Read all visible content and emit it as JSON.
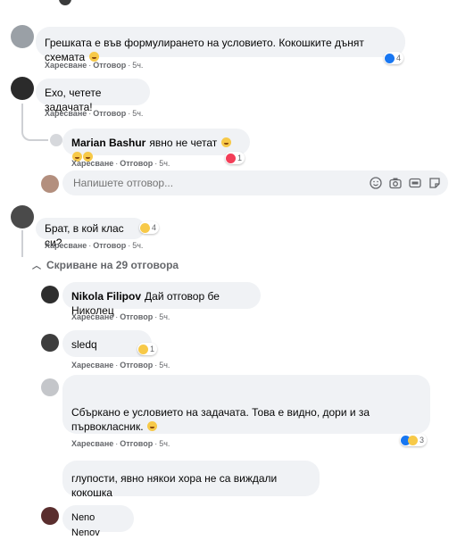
{
  "comments": [
    {
      "text": "Грешката е във формулирането на условието. Кокошките дънят схемата",
      "actions": {
        "like": "Харесване",
        "reply": "Отговор",
        "time": "5ч."
      },
      "reactions": {
        "count": "4"
      }
    },
    {
      "text": "Ехо, четете задачата!",
      "actions": {
        "like": "Харесване",
        "reply": "Отговор",
        "time": "5ч."
      }
    },
    {
      "author": "Marian Bashur",
      "text": "явно не четат",
      "actions": {
        "like": "Харесване",
        "reply": "Отговор",
        "time": "5ч."
      },
      "reactions": {
        "count": "1"
      }
    },
    {
      "text": "Брат, в кой клас си?",
      "actions": {
        "like": "Харесване",
        "reply": "Отговор",
        "time": "5ч."
      },
      "reactions": {
        "count": "4"
      }
    },
    {
      "author": "Nikola Filipov",
      "text": "Дай отговор бе Николец",
      "actions": {
        "like": "Харесване",
        "reply": "Отговор",
        "time": "5ч."
      }
    },
    {
      "text": "sledq",
      "actions": {
        "like": "Харесване",
        "reply": "Отговор",
        "time": "5ч."
      },
      "reactions": {
        "count": "1"
      }
    },
    {
      "text": "Сбъркано е условието на задачата. Това е видно, дори и за първокласник.",
      "actions": {
        "like": "Харесване",
        "reply": "Отговор",
        "time": "5ч."
      },
      "reactions": {
        "count": "3"
      }
    },
    {
      "text": "глупости, явно някои хора не са виждали кокошка"
    },
    {
      "author": "Neno Nenov"
    }
  ],
  "reply_input": {
    "placeholder": "Напишете отговор..."
  },
  "toggle_replies": "Скриване на 29 отговора",
  "icons": [
    "emoji-icon",
    "camera-icon",
    "gif-icon",
    "sticker-icon"
  ],
  "colors": {
    "bubble": "#f0f2f5",
    "meta": "#65676b",
    "like": "#1877f2",
    "heart": "#f33e58"
  }
}
